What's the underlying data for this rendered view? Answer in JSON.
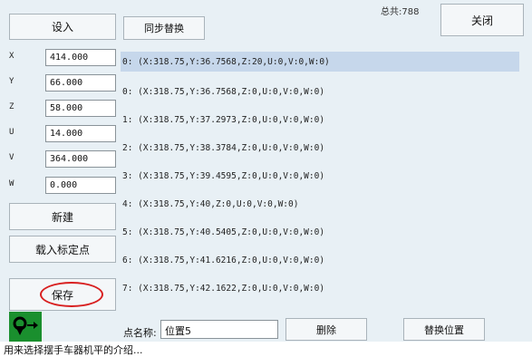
{
  "toolbar": {
    "set_in_label": "设入",
    "sync_replace_label": "同步替换",
    "total_label": "总共:788",
    "close_label": "关闭"
  },
  "axes": [
    {
      "name": "X",
      "value": "414.000"
    },
    {
      "name": "Y",
      "value": "66.000"
    },
    {
      "name": "Z",
      "value": "58.000"
    },
    {
      "name": "U",
      "value": "14.000"
    },
    {
      "name": "V",
      "value": "364.000"
    },
    {
      "name": "W",
      "value": "0.000"
    }
  ],
  "left_buttons": {
    "new_label": "新建",
    "load_calib_label": "载入标定点",
    "save_label": "保存"
  },
  "points": [
    "0: (X:318.75,Y:36.7568,Z:20,U:0,V:0,W:0)",
    "0: (X:318.75,Y:36.7568,Z:0,U:0,V:0,W:0)",
    "1: (X:318.75,Y:37.2973,Z:0,U:0,V:0,W:0)",
    "2: (X:318.75,Y:38.3784,Z:0,U:0,V:0,W:0)",
    "3: (X:318.75,Y:39.4595,Z:0,U:0,V:0,W:0)",
    "4: (X:318.75,Y:40,Z:0,U:0,V:0,W:0)",
    "5: (X:318.75,Y:40.5405,Z:0,U:0,V:0,W:0)",
    "6: (X:318.75,Y:41.6216,Z:0,U:0,V:0,W:0)",
    "7: (X:318.75,Y:42.1622,Z:0,U:0,V:0,W:0)"
  ],
  "bottom": {
    "name_label": "点名称:",
    "name_value": "位置5",
    "delete_label": "删除",
    "replace_label": "替换位置"
  },
  "caption": "用来选择摆手车器机平的介绍...",
  "icons": {
    "pin": "location-pin-arrow-icon"
  },
  "colors": {
    "background": "#e8f0f5",
    "selected_row": "#c6d7eb",
    "pin_bg": "#1a8f2e",
    "highlight_oval": "#d82020"
  }
}
